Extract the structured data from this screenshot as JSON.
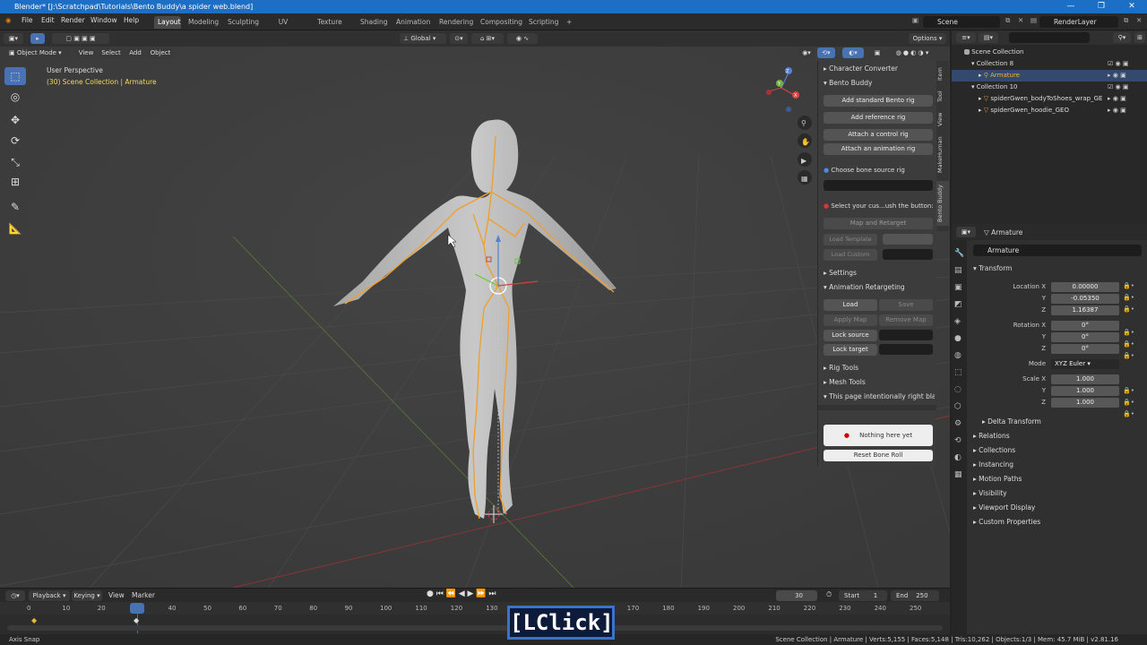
{
  "window": {
    "title": "Blender* [J:\\Scratchpad\\Tutorials\\Bento Buddy\\a spider web.blend]",
    "minimize": "—",
    "maximize": "❐",
    "close": "✕"
  },
  "menu": {
    "file": "File",
    "edit": "Edit",
    "render": "Render",
    "window": "Window",
    "help": "Help"
  },
  "workspaces": [
    "Layout",
    "Modeling",
    "Sculpting",
    "UV Editing",
    "Texture Paint",
    "Shading",
    "Animation",
    "Rendering",
    "Compositing",
    "Scripting"
  ],
  "workspace_add": "+",
  "scene": {
    "name": "Scene",
    "render_layer": "RenderLayer"
  },
  "viewport": {
    "transform_orientation": "Global",
    "options_label": "Options ▾",
    "mode": "Object Mode",
    "menu_view": "View",
    "menu_select": "Select",
    "menu_add": "Add",
    "menu_object": "Object",
    "overlay_title": "User Perspective",
    "overlay_sub": "(30) Scene Collection | Armature",
    "gizmo_x": "X",
    "gizmo_y": "Y",
    "gizmo_z": "Z"
  },
  "npanel": {
    "tabs": [
      "Item",
      "Tool",
      "View",
      "MakeHuman",
      "Bento Buddy"
    ],
    "character_converter": "Character Converter",
    "bento_buddy": "Bento Buddy",
    "add_standard": "Add standard Bento rig",
    "add_reference": "Add reference rig",
    "attach_control": "Attach a control rig",
    "attach_animation": "Attach an animation rig",
    "choose_source": "Choose bone source rig",
    "select_custom": "Select your cus...ush the button:",
    "map_retarget": "Map and Retarget",
    "load_template": "Load Template",
    "load_custom": "Load Custom",
    "settings": "Settings",
    "anim_retarget": "Animation Retargeting",
    "load": "Load",
    "save": "Save",
    "apply_map": "Apply Map",
    "remove_map": "Remove Map",
    "lock_source": "Lock source",
    "lock_target": "Lock target",
    "rig_tools": "Rig Tools",
    "mesh_tools": "Mesh Tools",
    "intentional": "This page intentionally right bla",
    "nothing_here": "Nothing here yet",
    "reset_bone_roll": "Reset Bone Roll"
  },
  "outliner": {
    "search_placeholder": "",
    "rows": [
      {
        "label": "Scene Collection"
      },
      {
        "label": "Collection 8"
      },
      {
        "label": "Armature"
      },
      {
        "label": "Collection 10"
      },
      {
        "label": "spiderGwen_bodyToShoes_wrap_GE"
      },
      {
        "label": "spiderGwen_hoodie_GEO"
      }
    ]
  },
  "properties": {
    "header": "Armature",
    "object_name": "Armature",
    "transform": "Transform",
    "location_x_label": "Location X",
    "y_label": "Y",
    "z_label": "Z",
    "location": [
      "0.00000",
      "-0.05350",
      "1.16387"
    ],
    "rotation_x_label": "Rotation X",
    "rotation": [
      "0°",
      "0°",
      "0°"
    ],
    "mode_label": "Mode",
    "mode": "XYZ Euler",
    "scale_x_label": "Scale X",
    "scale": [
      "1.000",
      "1.000",
      "1.000"
    ],
    "sections": [
      "Delta Transform",
      "Relations",
      "Collections",
      "Instancing",
      "Motion Paths",
      "Visibility",
      "Viewport Display",
      "Custom Properties"
    ]
  },
  "timeline": {
    "playback": "Playback ▾",
    "keying": "Keying ▾",
    "view": "View",
    "marker": "Marker",
    "current_frame": "30",
    "start_label": "Start",
    "start": "1",
    "end_label": "End",
    "end": "250",
    "ticks": [
      "0",
      "10",
      "20",
      "30",
      "40",
      "50",
      "60",
      "70",
      "80",
      "90",
      "100",
      "110",
      "120",
      "130",
      "140",
      "150",
      "160",
      "170",
      "180",
      "190",
      "200",
      "210",
      "220",
      "230",
      "240",
      "250"
    ]
  },
  "status": {
    "left": "Axis Snap",
    "right": "Scene Collection | Armature | Verts:5,155 | Faces:5,148 | Tris:10,262 | Objects:1/3 | Mem: 45.7 MiB | v2.81.16"
  },
  "overlay_click": "[LClick]",
  "colors": {
    "accent": "#4772b3",
    "bone": "#f0a030",
    "title_blue": "#1c6fc4",
    "active_orange": "#ffaf29"
  }
}
